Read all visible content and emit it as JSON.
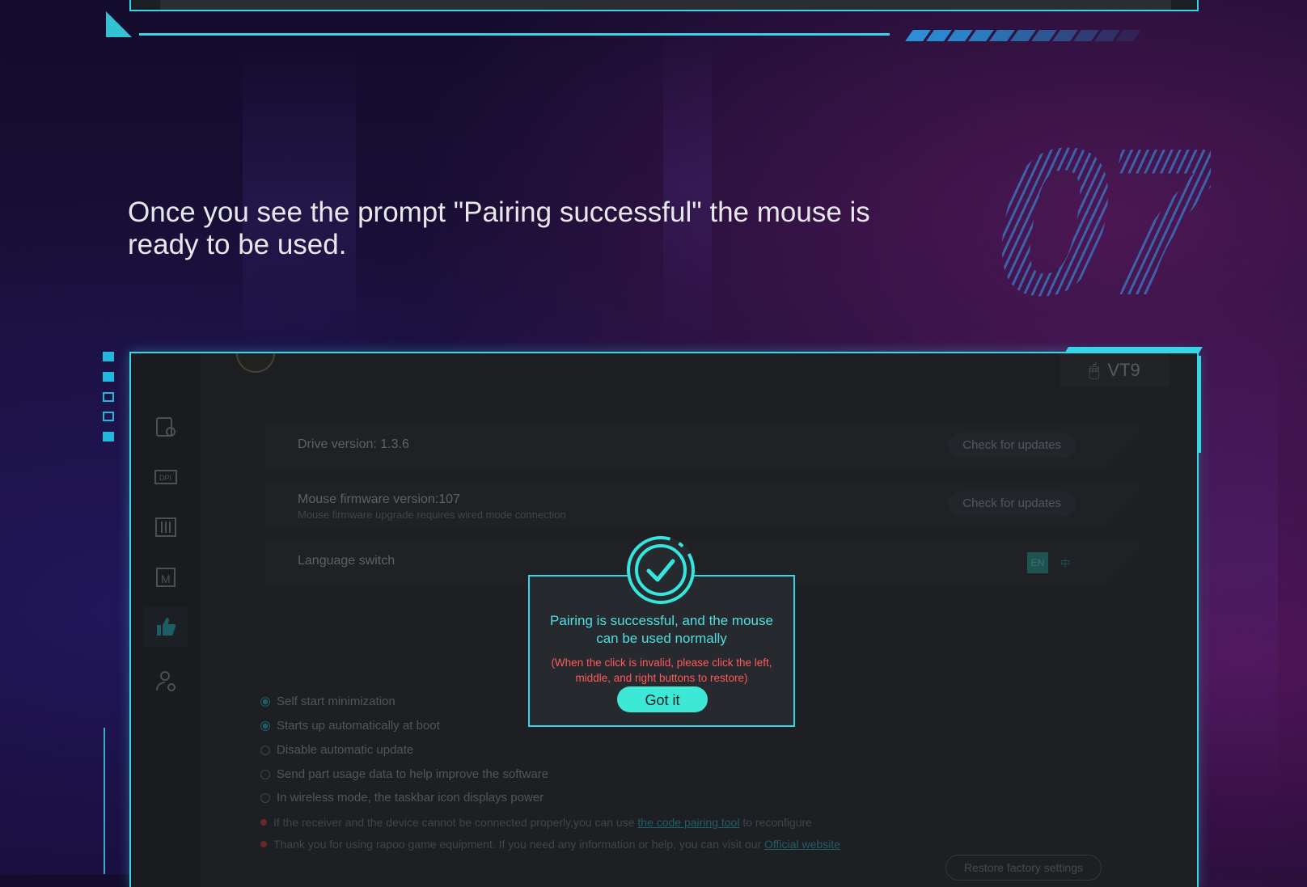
{
  "headline": "Once you see the prompt \"Pairing successful\" the mouse is ready to be used.",
  "step_number": "07",
  "app": {
    "model_name": "VT9",
    "drive": {
      "label": "Drive version: 1.3.6",
      "button": "Check for updates"
    },
    "firmware": {
      "label": "Mouse firmware version:107",
      "note": "Mouse firmware upgrade requires wired mode connection",
      "button": "Check for updates"
    },
    "language": {
      "label": "Language switch",
      "options": [
        "EN",
        "中"
      ],
      "selected": "EN"
    },
    "options": [
      {
        "label": "Self start minimization",
        "checked": true
      },
      {
        "label": "Starts up automatically at boot",
        "checked": true
      },
      {
        "label": "Disable automatic update",
        "checked": false
      },
      {
        "label": "Send part usage data to help improve the software",
        "checked": false
      },
      {
        "label": "In wireless mode, the taskbar icon displays power",
        "checked": false
      }
    ],
    "notes": [
      {
        "before": "If the receiver and the device cannot be connected properly,you can use ",
        "link": "the code pairing tool",
        "after": " to reconfigure"
      },
      {
        "before": "Thank you for using rapoo game equipment. If you need any information or help, you can visit our ",
        "link": "Official website",
        "after": ""
      }
    ],
    "restore_button": "Restore factory settings",
    "sidebar_icons": [
      "device-settings-icon",
      "dpi-icon",
      "equalizer-icon",
      "macro-icon",
      "thumbs-up-icon",
      "user-settings-icon"
    ]
  },
  "dialog": {
    "message": "Pairing is successful, and the mouse can be used normally",
    "warning": "(When the click is invalid, please click the left, middle, and right buttons to restore)",
    "button": "Got it"
  },
  "colors": {
    "accent": "#35d6e6",
    "button": "#3ee8d6",
    "warning": "#ff5a5a"
  }
}
